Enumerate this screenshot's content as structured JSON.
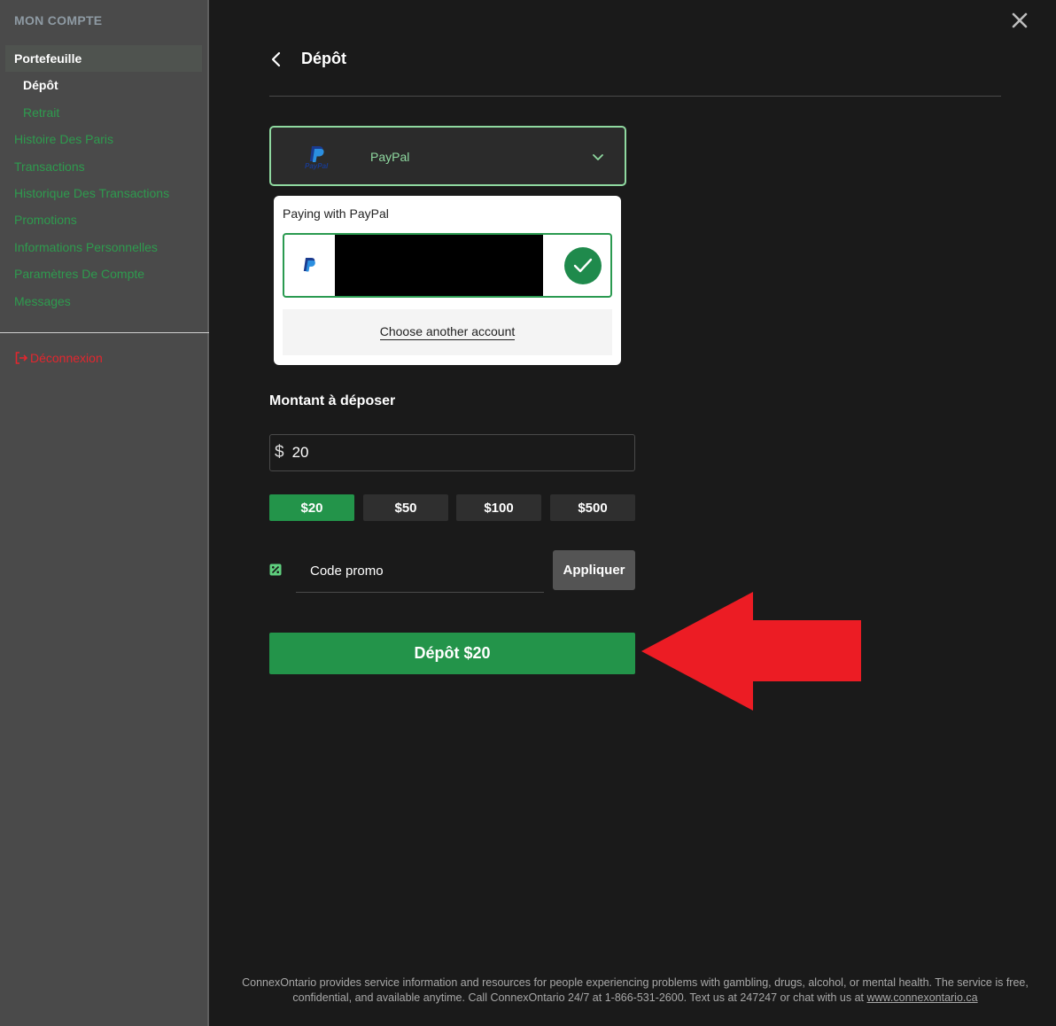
{
  "sidebar": {
    "title": "MON COMPTE",
    "section": "Portefeuille",
    "sub_items": [
      {
        "label": "Dépôt",
        "active": true
      },
      {
        "label": "Retrait",
        "active": false
      }
    ],
    "items": [
      "Histoire Des Paris",
      "Transactions",
      "Historique Des Transactions",
      "Promotions",
      "Informations Personnelles",
      "Paramètres De Compte",
      "Messages"
    ],
    "logout": "Déconnexion"
  },
  "header": {
    "title": "Dépôt"
  },
  "payment_method": {
    "label": "PayPal",
    "logo_text": "PayPal"
  },
  "paypal_panel": {
    "title": "Paying with PayPal",
    "choose_other": "Choose another account"
  },
  "amount": {
    "label": "Montant à déposer",
    "currency": "$",
    "value": "20",
    "presets": [
      "$20",
      "$50",
      "$100",
      "$500"
    ],
    "selected_preset": "$20"
  },
  "promo": {
    "placeholder": "Code promo",
    "apply_label": "Appliquer"
  },
  "deposit_button": "Dépôt $20",
  "footer": {
    "line1": "ConnexOntario provides service information and resources for people experiencing problems with gambling, drugs, alcohol, or mental health. The service is free,",
    "line2": "confidential, and available anytime. Call ConnexOntario 24/7 at 1-866-531-2600. Text us at 247247 or chat with us at",
    "link": "www.connexontario.ca"
  },
  "colors": {
    "accent_green": "#23944a",
    "link_green": "#2e9b4e",
    "outline_green": "#8fd9a0",
    "logout_red": "#e3262e",
    "annotation_arrow": "#ec1c24"
  }
}
